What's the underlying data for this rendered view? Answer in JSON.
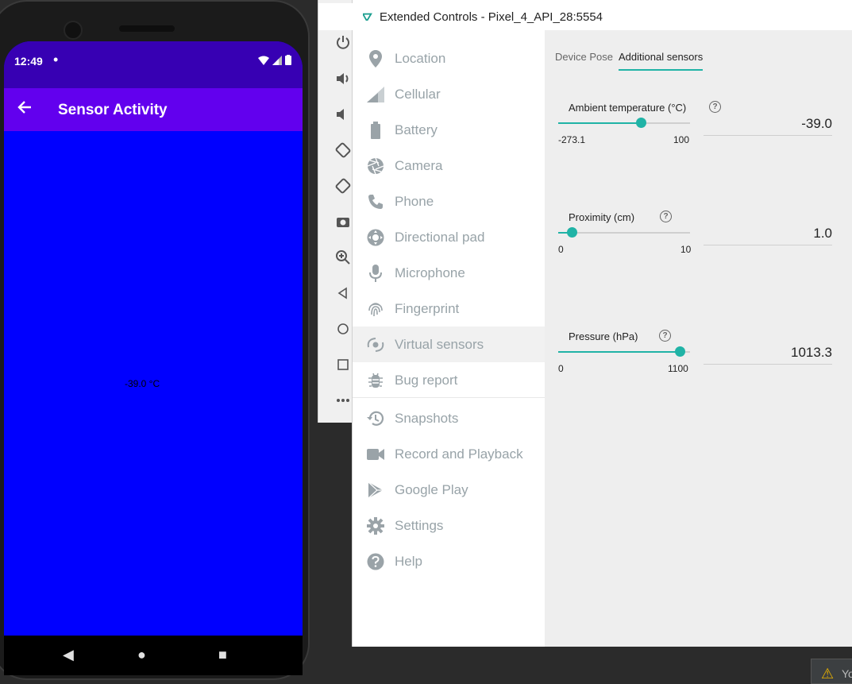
{
  "phone": {
    "status_time": "12:49",
    "status_dot": "•",
    "app_title": "Sensor Activity",
    "back_icon": "arrow-back-icon",
    "temperature_text": "-39.0 °C",
    "nav": {
      "back": "◀",
      "home": "●",
      "recents": "■"
    }
  },
  "window": {
    "title": "Extended Controls - Pixel_4_API_28:5554",
    "minimize": "–"
  },
  "nav": {
    "items": [
      {
        "label": "Location",
        "icon": "location-pin-icon"
      },
      {
        "label": "Cellular",
        "icon": "signal-icon"
      },
      {
        "label": "Battery",
        "icon": "battery-icon"
      },
      {
        "label": "Camera",
        "icon": "camera-aperture-icon"
      },
      {
        "label": "Phone",
        "icon": "phone-icon"
      },
      {
        "label": "Directional pad",
        "icon": "dpad-icon"
      },
      {
        "label": "Microphone",
        "icon": "microphone-icon"
      },
      {
        "label": "Fingerprint",
        "icon": "fingerprint-icon"
      },
      {
        "label": "Virtual sensors",
        "icon": "virtual-sensors-icon"
      },
      {
        "label": "Bug report",
        "icon": "bug-icon"
      },
      {
        "label": "Snapshots",
        "icon": "history-icon"
      },
      {
        "label": "Record and Playback",
        "icon": "video-camera-icon"
      },
      {
        "label": "Google Play",
        "icon": "play-store-icon"
      },
      {
        "label": "Settings",
        "icon": "gear-icon"
      },
      {
        "label": "Help",
        "icon": "help-icon"
      }
    ],
    "selected_index": 8
  },
  "tabs": {
    "device_pose": "Device Pose",
    "additional_sensors": "Additional sensors",
    "active": "additional_sensors"
  },
  "sensors": {
    "temperature": {
      "label": "Ambient temperature (°C)",
      "min": "-273.1",
      "max": "100",
      "value": "-39.0",
      "fraction": 0.627
    },
    "proximity": {
      "label": "Proximity (cm)",
      "min": "0",
      "max": "10",
      "value": "1.0",
      "fraction": 0.1
    },
    "pressure": {
      "label": "Pressure (hPa)",
      "min": "0",
      "max": "1100",
      "value": "1013.3",
      "fraction": 0.921
    }
  },
  "help_symbol": "?",
  "warning": {
    "text": "Yo"
  },
  "colors": {
    "accent": "#20b3a6",
    "status_bar": "#3700b3",
    "app_bar": "#6200ee",
    "screen": "#0000ff"
  }
}
